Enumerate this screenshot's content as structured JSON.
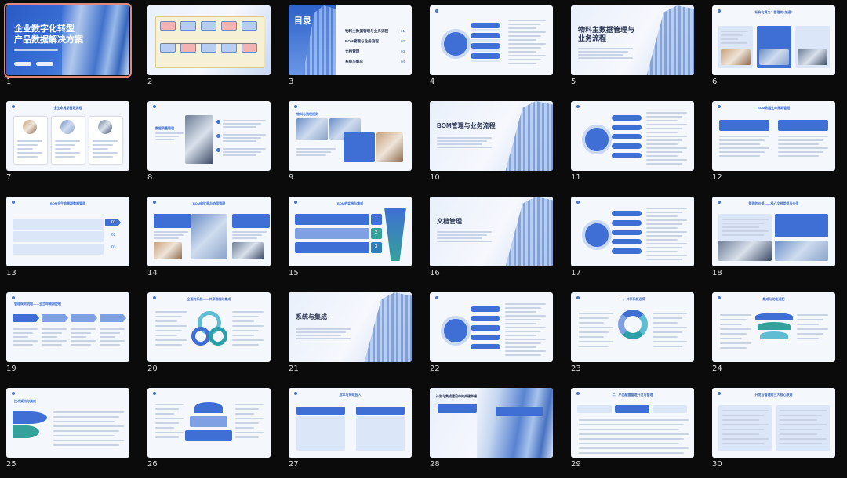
{
  "slides": [
    {
      "n": "1",
      "title": "企业数字化转型",
      "subtitle": "产品数据解决方案"
    },
    {
      "n": "2"
    },
    {
      "n": "3",
      "title": "目录",
      "toc": [
        "物料主数据管理与业务流程",
        "BOM管理与业务流程",
        "文档管理",
        "系统与集成"
      ],
      "toc_nums": [
        "01",
        "02",
        "03",
        "04"
      ]
    },
    {
      "n": "4"
    },
    {
      "n": "5",
      "title": "物料主数据管理与",
      "title2": "业务流程"
    },
    {
      "n": "6",
      "title": "私有化算力：管理的“加速”"
    },
    {
      "n": "7",
      "title": "全生命周期管理流程"
    },
    {
      "n": "8",
      "title": "数据质量管理"
    },
    {
      "n": "9",
      "title": "物料与流程规则"
    },
    {
      "n": "10",
      "title": "BOM管理与业务流程"
    },
    {
      "n": "11"
    },
    {
      "n": "12",
      "title": "BOM数据生命周期管理"
    },
    {
      "n": "13",
      "title": "BOM全生命周期数据管理",
      "nums": [
        "01",
        "02",
        "03"
      ]
    },
    {
      "n": "14",
      "title": "BOM的扩展与协同管理"
    },
    {
      "n": "15",
      "title": "BOM的实施与集成",
      "nums": [
        "1",
        "2",
        "3"
      ]
    },
    {
      "n": "16",
      "title": "文档管理"
    },
    {
      "n": "17"
    },
    {
      "n": "18",
      "title": "管理的价值——核心文档类型与价值"
    },
    {
      "n": "19",
      "title": "管理规则流程——全生命周期控制"
    },
    {
      "n": "20",
      "title": "全面的系统——共享流程与集成"
    },
    {
      "n": "21",
      "title": "系统与集成"
    },
    {
      "n": "22"
    },
    {
      "n": "23",
      "title": "一、共享系统选择"
    },
    {
      "n": "24",
      "title": "集成与功能适配"
    },
    {
      "n": "25",
      "title": "技术架构与集成"
    },
    {
      "n": "26"
    },
    {
      "n": "27",
      "title": "成本与持续投入"
    },
    {
      "n": "28",
      "title": "计划与集成建设中的关键举措"
    },
    {
      "n": "29",
      "title": "二、产品配置管理开发与管理"
    },
    {
      "n": "30",
      "title": "开发与管理的三大核心原则"
    }
  ]
}
